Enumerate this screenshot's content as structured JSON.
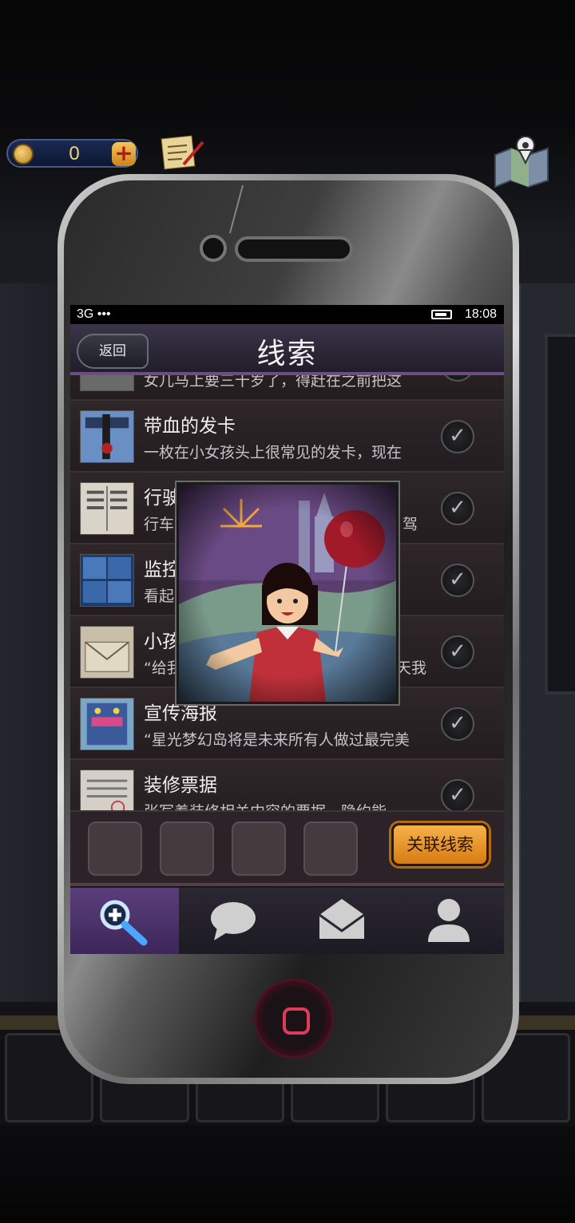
{
  "hud": {
    "coins": "0",
    "add_symbol": "+"
  },
  "status_bar": {
    "signal": "3G •••",
    "time": "18:08"
  },
  "header": {
    "back_label": "返回",
    "title": "线索"
  },
  "clues": [
    {
      "name": "",
      "desc": "女儿马上要三十岁了，得赶在之前把这",
      "checked": true
    },
    {
      "name": "带血的发卡",
      "desc": "一枚在小女孩头上很常见的发卡，现在",
      "checked": true
    },
    {
      "name": "行驶",
      "desc": "行车",
      "desc_tail": "驾",
      "checked": true
    },
    {
      "name": "监控",
      "desc": "看起",
      "checked": true
    },
    {
      "name": "小孩",
      "desc": "“给我",
      "desc_tail": "天我",
      "checked": true
    },
    {
      "name": "宣传海报",
      "desc": "“星光梦幻岛将是未来所有人做过最完美",
      "checked": true
    },
    {
      "name": "装修票据",
      "desc": "张写着装修相关内容的票据，隐约能",
      "checked": true
    }
  ],
  "clip_bar": {
    "link_label": "关联线索",
    "empty_slots": 4
  },
  "tabs": [
    {
      "icon": "search-icon",
      "active": true
    },
    {
      "icon": "chat-bubble-icon",
      "active": false
    },
    {
      "icon": "mail-icon",
      "active": false
    },
    {
      "icon": "person-icon",
      "active": false
    }
  ],
  "popup": {
    "icon": "girl-with-balloon-drawing"
  },
  "colors": {
    "accent_purple": "#5b3e7c",
    "link_button": "#f5b24a",
    "home_button_ring": "#e03a5a"
  }
}
